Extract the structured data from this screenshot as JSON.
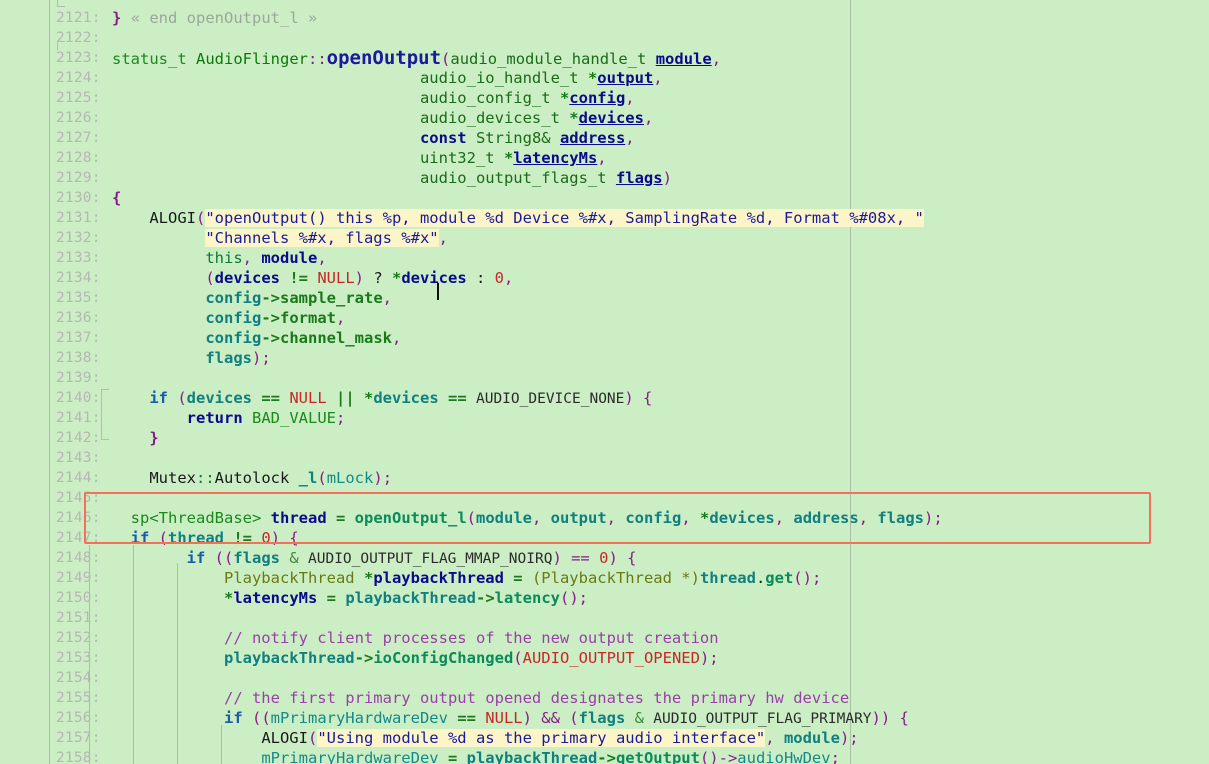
{
  "editor": {
    "background_color": "#cbeec5",
    "gutter_color": "#b4b8b2",
    "ruler_color": "#a9bfa5",
    "highlight_box_color": "#f4705a",
    "string_highlight_color": "#fbf5c8",
    "first_line_number": 2121,
    "last_line_number": 2158
  },
  "lines": [
    {
      "n": "2121:",
      "text": "} « end openOutput_l »"
    },
    {
      "n": "2122:",
      "text": ""
    },
    {
      "n": "2123:",
      "text": "status_t AudioFlinger::openOutput(audio_module_handle_t module,"
    },
    {
      "n": "2124:",
      "text": "                                 audio_io_handle_t *output,"
    },
    {
      "n": "2125:",
      "text": "                                 audio_config_t *config,"
    },
    {
      "n": "2126:",
      "text": "                                 audio_devices_t *devices,"
    },
    {
      "n": "2127:",
      "text": "                                 const String8& address,"
    },
    {
      "n": "2128:",
      "text": "                                 uint32_t *latencyMs,"
    },
    {
      "n": "2129:",
      "text": "                                 audio_output_flags_t flags)"
    },
    {
      "n": "2130:",
      "text": "{"
    },
    {
      "n": "2131:",
      "text": "    ALOGI(\"openOutput() this %p, module %d Device %#x, SamplingRate %d, Format %#08x, \""
    },
    {
      "n": "2132:",
      "text": "          \"Channels %#x, flags %#x\","
    },
    {
      "n": "2133:",
      "text": "          this, module,"
    },
    {
      "n": "2134:",
      "text": "          (devices != NULL) ? *devices : 0,"
    },
    {
      "n": "2135:",
      "text": "          config->sample_rate,"
    },
    {
      "n": "2136:",
      "text": "          config->format,"
    },
    {
      "n": "2137:",
      "text": "          config->channel_mask,"
    },
    {
      "n": "2138:",
      "text": "          flags);"
    },
    {
      "n": "2139:",
      "text": ""
    },
    {
      "n": "2140:",
      "text": "    if (devices == NULL || *devices == AUDIO_DEVICE_NONE) {"
    },
    {
      "n": "2141:",
      "text": "        return BAD_VALUE;"
    },
    {
      "n": "2142:",
      "text": "    }"
    },
    {
      "n": "2143:",
      "text": ""
    },
    {
      "n": "2144:",
      "text": "    Mutex::Autolock _l(mLock);"
    },
    {
      "n": "2145:",
      "text": ""
    },
    {
      "n": "2146:",
      "text": "    sp<ThreadBase> thread = openOutput_l(module, output, config, *devices, address, flags);"
    },
    {
      "n": "2147:",
      "text": "    if (thread != 0) {"
    },
    {
      "n": "2148:",
      "text": "        if ((flags & AUDIO_OUTPUT_FLAG_MMAP_NOIRQ) == 0) {"
    },
    {
      "n": "2149:",
      "text": "            PlaybackThread *playbackThread = (PlaybackThread *)thread.get();"
    },
    {
      "n": "2150:",
      "text": "            *latencyMs = playbackThread->latency();"
    },
    {
      "n": "2151:",
      "text": ""
    },
    {
      "n": "2152:",
      "text": "            // notify client processes of the new output creation"
    },
    {
      "n": "2153:",
      "text": "            playbackThread->ioConfigChanged(AUDIO_OUTPUT_OPENED);"
    },
    {
      "n": "2154:",
      "text": ""
    },
    {
      "n": "2155:",
      "text": "            // the first primary output opened designates the primary hw device"
    },
    {
      "n": "2156:",
      "text": "            if ((mPrimaryHardwareDev == NULL) && (flags & AUDIO_OUTPUT_FLAG_PRIMARY)) {"
    },
    {
      "n": "2157:",
      "text": "                ALOGI(\"Using module %d as the primary audio interface\", module);"
    },
    {
      "n": "2158:",
      "text": "                mPrimaryHardwareDev = playbackThread->getOutput()->audioHwDev;"
    }
  ],
  "tokens": {
    "l2121": {
      "brace": "}",
      "fold": "« end openOutput_l »"
    },
    "l2123": {
      "type": "status_t",
      "cls": "AudioFlinger",
      "scope": "::",
      "fn": "openOutput",
      "open": "(",
      "ptype": "audio_module_handle_t",
      "param": "module",
      "comma": ","
    },
    "l2124": {
      "ptype": "audio_io_handle_t",
      "star": "*",
      "param": "output",
      "comma": ","
    },
    "l2125": {
      "ptype": "audio_config_t",
      "star": "*",
      "param": "config",
      "comma": ","
    },
    "l2126": {
      "ptype": "audio_devices_t",
      "star": "*",
      "param": "devices",
      "comma": ","
    },
    "l2127": {
      "kw": "const",
      "ptype": "String8&",
      "param": "address",
      "comma": ","
    },
    "l2128": {
      "ptype": "uint32_t",
      "star": "*",
      "param": "latencyMs",
      "comma": ","
    },
    "l2129": {
      "ptype": "audio_output_flags_t",
      "param": "flags",
      "close": ")"
    },
    "l2130": {
      "brace": "{"
    },
    "l2131": {
      "macro": "ALOGI",
      "open": "(",
      "str": "\"openOutput() this %p, module %d Device %#x, SamplingRate %d, Format %#08x, \""
    },
    "l2132": {
      "str": "\"Channels %#x, flags %#x\"",
      "comma": ","
    },
    "l2133": {
      "kw": "this",
      "comma1": ", ",
      "var": "module",
      "comma2": ","
    },
    "l2134": {
      "open": "(",
      "var": "devices",
      "op": " != ",
      "const": "NULL",
      "close": ")",
      "q": " ? ",
      "star": "*",
      "var2": "devices",
      "colon": " : ",
      "num": "0",
      "comma": ","
    },
    "l2135": {
      "var": "config",
      "arrow": "->",
      "member": "sample_rate",
      "comma": ","
    },
    "l2136": {
      "var": "config",
      "arrow": "->",
      "member": "format",
      "comma": ","
    },
    "l2137": {
      "var": "config",
      "arrow": "->",
      "member": "channel_mask",
      "comma": ","
    },
    "l2138": {
      "var": "flags",
      "close": ");"
    },
    "l2140": {
      "kw": "if",
      "open": " (",
      "var": "devices",
      "op": " == ",
      "const": "NULL",
      "or": " || ",
      "star": "*",
      "var2": "devices",
      "op2": " == ",
      "macro": "AUDIO_DEVICE_NONE",
      "close": ") {"
    },
    "l2141": {
      "kw": "return",
      "macro": "BAD_VALUE",
      "semi": ";"
    },
    "l2142": {
      "brace": "}"
    },
    "l2144": {
      "cls": "Mutex",
      "scope": "::",
      "type": "Autolock",
      "var": "_l",
      "open": "(",
      "member": "mLock",
      "close": ");"
    },
    "l2146": {
      "type": "sp<ThreadBase>",
      "var": "thread",
      "eq": " = ",
      "fn": "openOutput_l",
      "open": "(",
      "a1": "module",
      "a2": "output",
      "a3": "config",
      "star": "*",
      "a4": "devices",
      "a5": "address",
      "a6": "flags",
      "close": ");"
    },
    "l2147": {
      "kw": "if",
      "open": " (",
      "var": "thread",
      "op": " != ",
      "num": "0",
      "close": ") {"
    },
    "l2148": {
      "kw": "if",
      "open": " ((",
      "var": "flags",
      "amp": " & ",
      "macro": "AUDIO_OUTPUT_FLAG_MMAP_NOIRQ",
      "close": ") == ",
      "num": "0",
      "brace": ") {"
    },
    "l2149": {
      "type": "PlaybackThread",
      "star": " *",
      "var": "playbackThread",
      "eq": " = ",
      "cast": "(PlaybackThread *)",
      "obj": "thread",
      "dot": ".",
      "fn": "get",
      "close": "();"
    },
    "l2150": {
      "star": "*",
      "var": "latencyMs",
      "eq": " = ",
      "obj": "playbackThread",
      "arrow": "->",
      "fn": "latency",
      "close": "();"
    },
    "l2152": {
      "cmt": "// notify client processes of the new output creation"
    },
    "l2153": {
      "obj": "playbackThread",
      "arrow": "->",
      "fn": "ioConfigChanged",
      "open": "(",
      "macro": "AUDIO_OUTPUT_OPENED",
      "close": ");"
    },
    "l2155": {
      "cmt": "// the first primary output opened designates the primary hw device"
    },
    "l2156": {
      "kw": "if",
      "open": " ((",
      "var": "mPrimaryHardwareDev",
      "op": " == ",
      "const": "NULL",
      "and": ") && (",
      "var2": "flags",
      "amp": " & ",
      "macro": "AUDIO_OUTPUT_FLAG_PRIMARY",
      "close": ")) {"
    },
    "l2157": {
      "macro": "ALOGI",
      "open": "(",
      "str": "\"Using module %d as the primary audio interface\"",
      "comma": ", ",
      "var": "module",
      "close": ");"
    },
    "l2158": {
      "var": "mPrimaryHardwareDev",
      "eq": " = ",
      "obj": "playbackThread",
      "arrow": "->",
      "fn": "getOutput",
      "mid": "()->",
      "member": "audioHwDev",
      "semi": ";"
    }
  }
}
